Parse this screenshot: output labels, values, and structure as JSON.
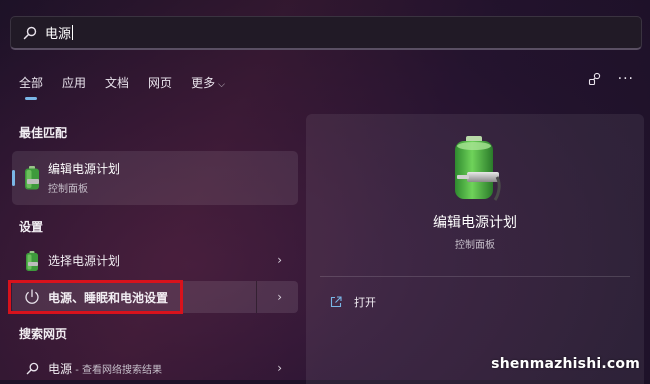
{
  "search": {
    "query": "电源"
  },
  "tabs": [
    {
      "label": "全部",
      "active": true
    },
    {
      "label": "应用"
    },
    {
      "label": "文档"
    },
    {
      "label": "网页"
    },
    {
      "label": "更多"
    }
  ],
  "sections": {
    "best_match": "最佳匹配",
    "settings": "设置",
    "web": "搜索网页"
  },
  "best_match": {
    "title": "编辑电源计划",
    "subtitle": "控制面板",
    "icon": "battery-plug-icon"
  },
  "settings_items": [
    {
      "label": "选择电源计划",
      "icon": "battery-icon"
    },
    {
      "label": "电源、睡眠和电池设置",
      "icon": "power-icon"
    }
  ],
  "web_item": {
    "label": "电源",
    "suffix": " - 查看网络搜索结果",
    "icon": "search-icon"
  },
  "detail": {
    "title": "编辑电源计划",
    "subtitle": "控制面板",
    "open_label": "打开"
  },
  "watermark": "shenmazhishi.com",
  "colors": {
    "accent": "#7ab6e6",
    "highlight_box": "#d8121c"
  }
}
